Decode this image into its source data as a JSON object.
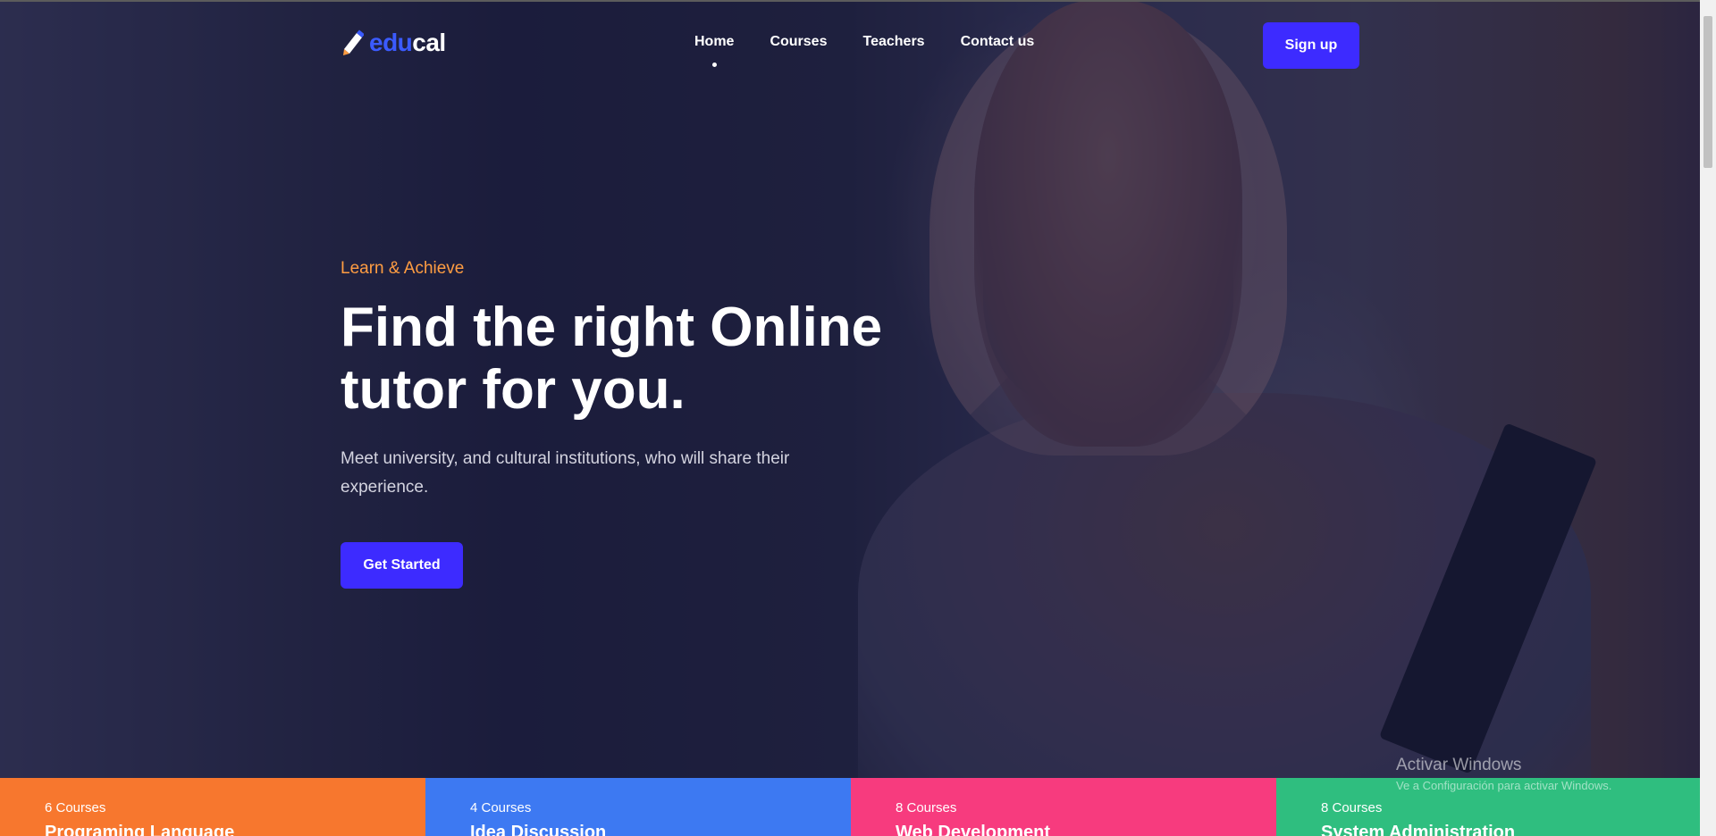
{
  "nav": {
    "logo_part1": "edu",
    "logo_part2": "cal",
    "items": [
      {
        "label": "Home",
        "active": true
      },
      {
        "label": "Courses"
      },
      {
        "label": "Teachers"
      },
      {
        "label": "Contact us"
      }
    ],
    "signup_label": "Sign up"
  },
  "hero": {
    "eyebrow": "Learn & Achieve",
    "title": "Find the right Online tutor for you.",
    "description": "Meet university, and cultural institutions, who will share their experience.",
    "cta_label": "Get Started"
  },
  "categories": [
    {
      "count": "6 Courses",
      "name": "Programing Language",
      "color": "#f7772e"
    },
    {
      "count": "4 Courses",
      "name": "Idea Discussion",
      "color": "#3d79f2"
    },
    {
      "count": "8 Courses",
      "name": "Web Development",
      "color": "#f73b7e"
    },
    {
      "count": "8 Courses",
      "name": "System Administration",
      "color": "#2fbe7f"
    }
  ],
  "watermark": {
    "line1": "Activar Windows",
    "line2": "Ve a Configuración para activar Windows."
  },
  "colors": {
    "accent": "#3d2bff",
    "eyebrow": "#ff9d42",
    "logo_blue": "#3b5bff"
  }
}
